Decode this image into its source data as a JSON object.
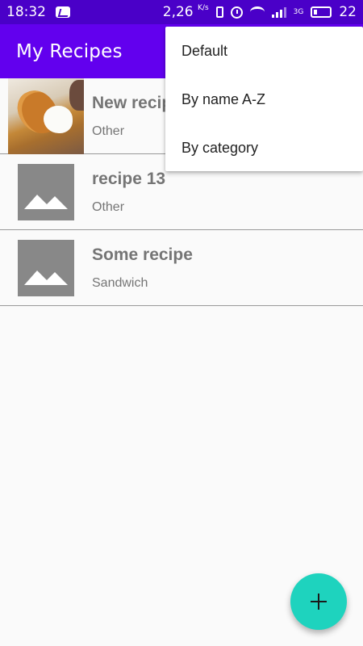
{
  "status_bar": {
    "time": "18:32",
    "net_speed": "2,26",
    "net_speed_unit": "K/s",
    "net_type": "3G",
    "battery_level": "22",
    "icons": [
      "vk-icon",
      "vibrate-icon",
      "alarm-icon",
      "wifi-icon",
      "signal-icon",
      "battery-icon"
    ]
  },
  "app_bar": {
    "title": "My Recipes"
  },
  "recipes": [
    {
      "name": "New recipe",
      "category": "Other",
      "thumbnail": "photo"
    },
    {
      "name": "recipe 13",
      "category": "Other",
      "thumbnail": "placeholder-image-icon"
    },
    {
      "name": "Some recipe",
      "category": "Sandwich",
      "thumbnail": "placeholder-image-icon"
    }
  ],
  "sort_menu": {
    "items": [
      {
        "label": "Default"
      },
      {
        "label": "By name A-Z"
      },
      {
        "label": "By category"
      }
    ]
  },
  "fab": {
    "icon": "plus-icon",
    "color": "#1ed3be"
  },
  "colors": {
    "primary": "#6200ee",
    "primary_dark": "#4a00c8",
    "accent": "#1ed3be"
  }
}
